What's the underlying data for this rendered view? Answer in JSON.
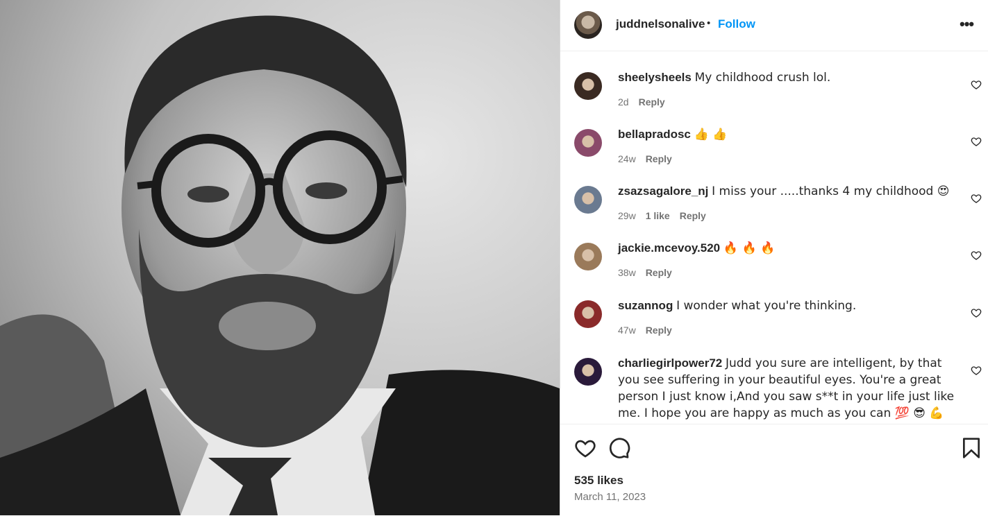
{
  "post": {
    "username": "juddnelsonalive",
    "separator": "•",
    "follow_label": "Follow",
    "more_icon": "more-options-icon",
    "likes": "535 likes",
    "date": "March 11, 2023"
  },
  "comments": [
    {
      "user": "sheelysheels",
      "text": "My childhood crush lol.",
      "age": "2d",
      "likes": "",
      "reply": "Reply",
      "avatar_color": "#3a2a22"
    },
    {
      "user": "bellapradosc",
      "text": "👍 👍",
      "age": "24w",
      "likes": "",
      "reply": "Reply",
      "avatar_color": "#8a4a6a"
    },
    {
      "user": "zsazsagalore_nj",
      "text": "I miss your .....thanks 4 my childhood 😍",
      "age": "29w",
      "likes": "1 like",
      "reply": "Reply",
      "avatar_color": "#6a7a90"
    },
    {
      "user": "jackie.mcevoy.520",
      "text": "🔥 🔥 🔥",
      "age": "38w",
      "likes": "",
      "reply": "Reply",
      "avatar_color": "#9a7a5a"
    },
    {
      "user": "suzannog",
      "text": "I wonder what you're thinking.",
      "age": "47w",
      "likes": "",
      "reply": "Reply",
      "avatar_color": "#8a2a2a"
    },
    {
      "user": "charliegirlpower72",
      "text": "Judd you sure are intelligent, by that you see suffering in your beautiful eyes. You're a great person I just know i,And you saw s**t in your life just like me. I hope you are happy as much as you can 💯 😎 💪",
      "age": "",
      "likes": "",
      "reply": "",
      "avatar_color": "#2a1a3a"
    }
  ]
}
